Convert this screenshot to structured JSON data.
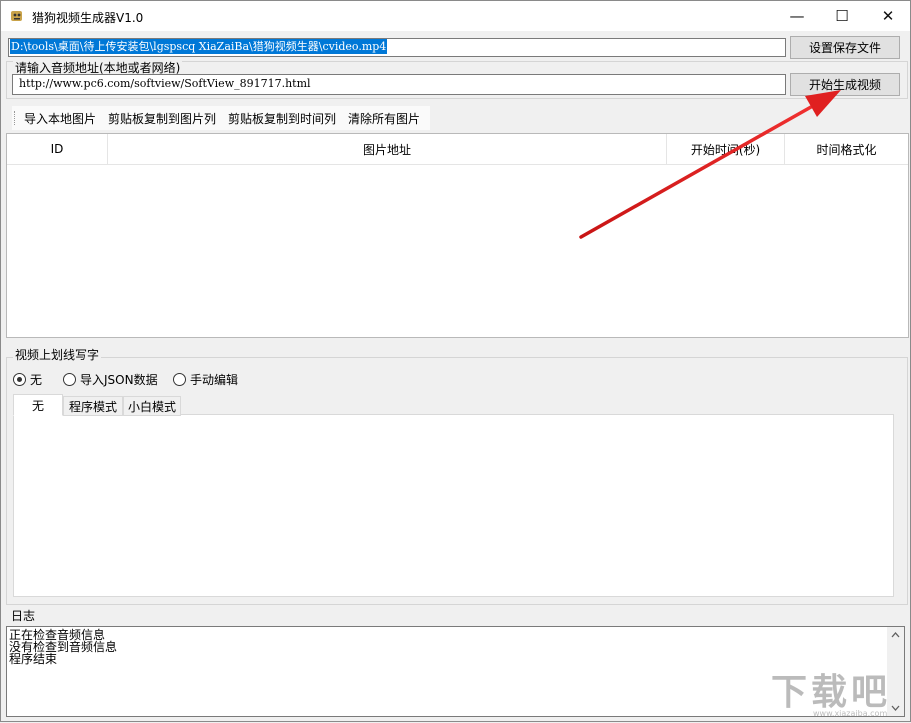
{
  "window": {
    "title": "猎狗视频生成器V1.0",
    "minimize_glyph": "—",
    "maximize_glyph": "☐",
    "close_glyph": "✕"
  },
  "output": {
    "path": "D:\\tools\\桌面\\待上传安装包\\lgspscq XiaZaiBa\\猎狗视频生器\\cvideo.mp4",
    "save_button": "设置保存文件"
  },
  "audio": {
    "group_label": "请输入音频地址(本地或者网络)",
    "value": "http://www.pc6.com/softview/SoftView_891717.html",
    "generate_button": "开始生成视频"
  },
  "toolbar": {
    "items": [
      "导入本地图片",
      "剪贴板复制到图片列",
      "剪贴板复制到时间列",
      "清除所有图片"
    ]
  },
  "grid": {
    "columns": [
      "ID",
      "图片地址",
      "开始时间(秒)",
      "时间格式化"
    ]
  },
  "draw": {
    "group_label": "视频上划线写字",
    "radios": [
      "无",
      "导入JSON数据",
      "手动编辑"
    ],
    "selected": "无",
    "tabs": [
      "无",
      "程序模式",
      "小白模式"
    ]
  },
  "log": {
    "label": "日志",
    "lines": [
      "正在检查音频信息",
      "没有检查到音频信息",
      "程序结束"
    ]
  },
  "watermark": {
    "text": "下载吧",
    "sub": "www.xiazaiba.com"
  },
  "colors": {
    "selection": "#0078d7",
    "arrow": "#e02020"
  }
}
